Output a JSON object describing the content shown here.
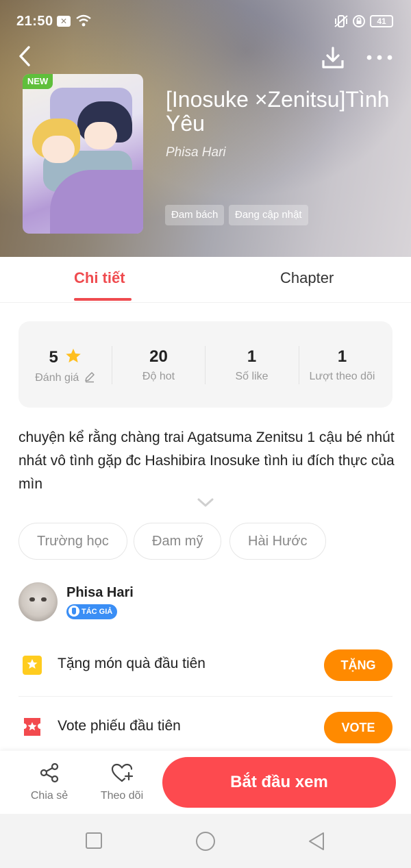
{
  "status_bar": {
    "time": "21:50",
    "battery": "41"
  },
  "comic": {
    "badge": "NEW",
    "title": "[Inosuke ×Zenitsu]Tình Yêu",
    "author": "Phisa Hari",
    "tags": [
      "Đam bách",
      "Đang cập nhật"
    ]
  },
  "tabs": {
    "detail": "Chi tiết",
    "chapter": "Chapter"
  },
  "stats": [
    {
      "value": "5",
      "label": "Đánh giá"
    },
    {
      "value": "20",
      "label": "Độ hot"
    },
    {
      "value": "1",
      "label": "Số like"
    },
    {
      "value": "1",
      "label": "Lượt theo dõi"
    }
  ],
  "description": "chuyện kể rằng chàng trai Agatsuma Zenitsu 1 cậu bé nhút nhát vô tình gặp đc Hashibira Inosuke tình iu đích thực của mìn",
  "genres": [
    "Trường học",
    "Đam mỹ",
    "Hài Hước"
  ],
  "author_card": {
    "name": "Phisa Hari",
    "role": "TÁC GIẢ"
  },
  "actions": [
    {
      "label": "Tặng món quà đầu tiên",
      "button": "TẶNG"
    },
    {
      "label": "Vote phiếu đầu tiên",
      "button": "VOTE"
    }
  ],
  "bottom_bar": {
    "share": "Chia sẻ",
    "follow": "Theo dõi",
    "start": "Bắt đầu xem"
  },
  "colors": {
    "accent": "#ef4b4f",
    "orange": "#ff8a00",
    "badge_new": "#5fbf3b",
    "author_badge": "#3a8ef5"
  },
  "icons": [
    "back-icon",
    "download-icon",
    "more-icon",
    "star-icon",
    "edit-icon",
    "chevron-down-icon",
    "gift-icon",
    "ticket-icon",
    "share-icon",
    "heart-plus-icon"
  ]
}
